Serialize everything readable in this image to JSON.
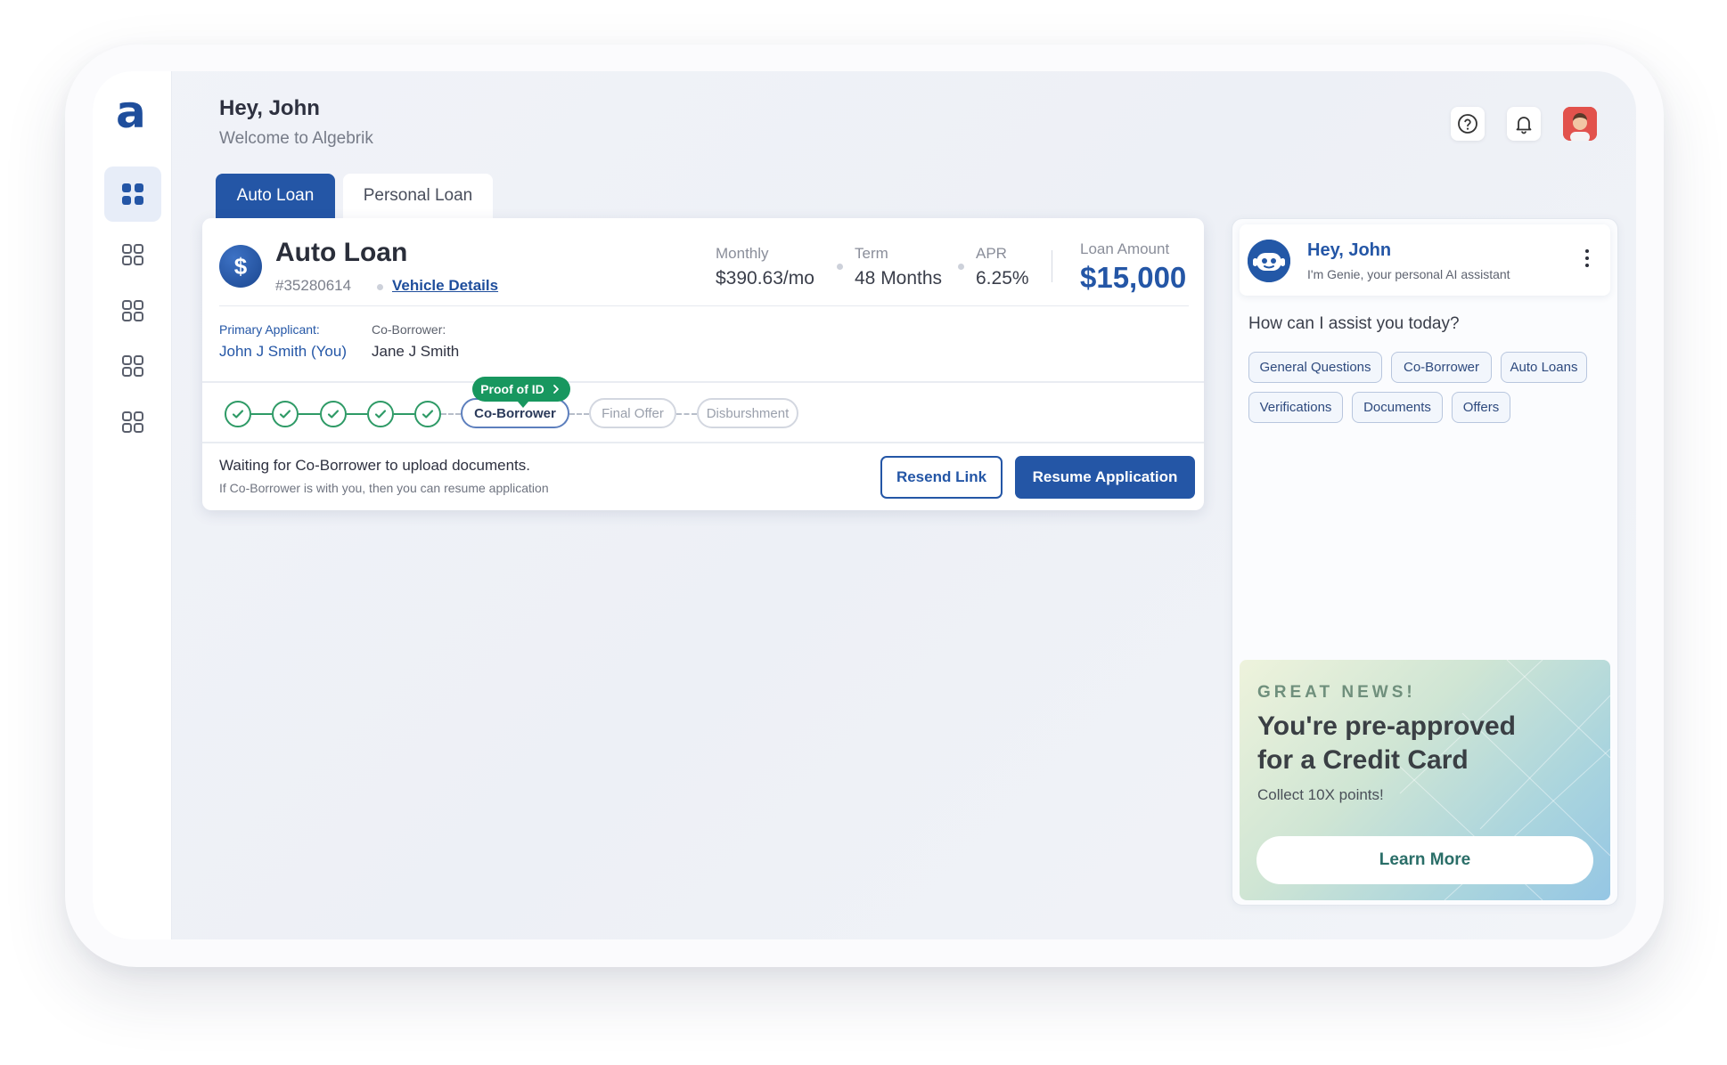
{
  "brand": {
    "logo_letter": "a",
    "accent": "#2456a6",
    "success": "#18975f"
  },
  "sidebar": {
    "items": [
      {
        "name": "dashboard",
        "icon": "grid-filled-icon",
        "active": true
      },
      {
        "name": "menu-2",
        "icon": "grid-outline-icon",
        "active": false
      },
      {
        "name": "menu-3",
        "icon": "grid-outline-icon",
        "active": false
      },
      {
        "name": "menu-4",
        "icon": "grid-outline-icon",
        "active": false
      },
      {
        "name": "menu-5",
        "icon": "grid-outline-icon",
        "active": false
      }
    ]
  },
  "header": {
    "greeting": "Hey, John",
    "welcome": "Welcome to Algebrik",
    "icons": [
      "help-icon",
      "bell-icon",
      "user-avatar"
    ]
  },
  "tabs": [
    {
      "label": "Auto Loan",
      "active": true
    },
    {
      "label": "Personal Loan",
      "active": false
    }
  ],
  "loan": {
    "icon_symbol": "$",
    "title": "Auto Loan",
    "id": "#35280614",
    "vehicle_link": "Vehicle Details",
    "monthly_label": "Monthly",
    "monthly_value": "$390.63/mo",
    "term_label": "Term",
    "term_value": "48 Months",
    "apr_label": "APR",
    "apr_value": "6.25%",
    "amount_label": "Loan Amount",
    "amount_value": "$15,000",
    "primary_label": "Primary Applicant:",
    "primary_name": "John J Smith (You)",
    "coborrower_label": "Co-Borrower:",
    "coborrower_name": "Jane J Smith"
  },
  "progress": {
    "completed_steps": 5,
    "tooltip": "Proof of ID",
    "current_step": "Co-Borrower",
    "future_steps": [
      "Final Offer",
      "Disburshment"
    ]
  },
  "status": {
    "title": "Waiting for Co-Borrower to upload documents.",
    "subtitle": "If Co-Borrower is with you, then you can resume application",
    "resend_label": "Resend Link",
    "resume_label": "Resume Application"
  },
  "assistant": {
    "name": "Hey, John",
    "intro": "I'm Genie, your personal AI assistant",
    "question": "How can I assist you today?",
    "chips": [
      "General Questions",
      "Co-Borrower",
      "Auto Loans",
      "Verifications",
      "Documents",
      "Offers"
    ]
  },
  "promo": {
    "kicker": "GREAT NEWS!",
    "title": "You're pre-approved for a Credit Card",
    "subtitle": "Collect 10X points!",
    "button": "Learn More"
  }
}
